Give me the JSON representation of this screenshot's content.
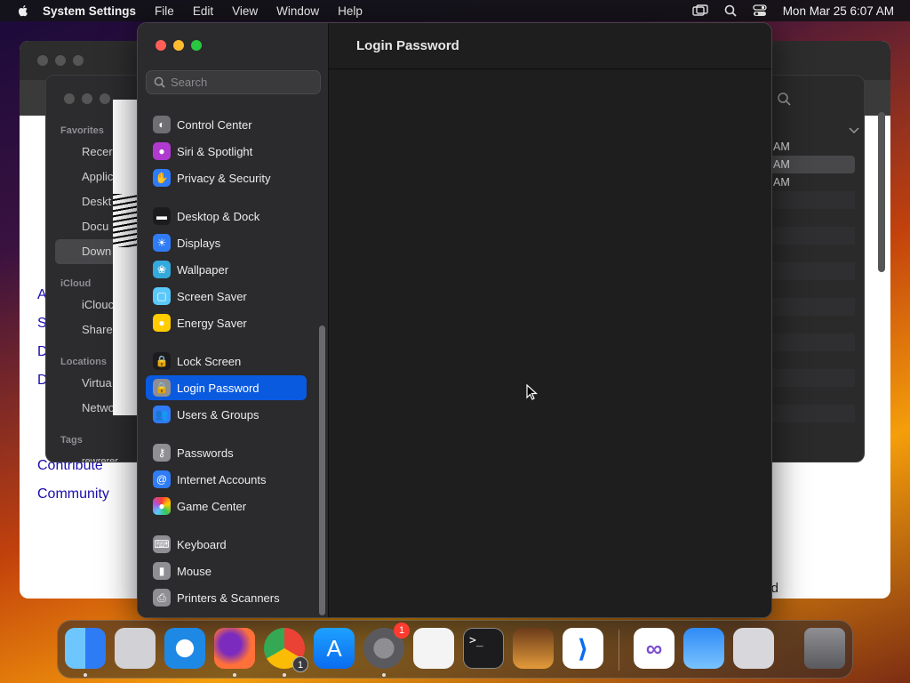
{
  "menubar": {
    "app_name": "System Settings",
    "menus": [
      "File",
      "Edit",
      "View",
      "Window",
      "Help"
    ],
    "clock": "Mon Mar 25  6:07 AM"
  },
  "background_browser": {
    "links": [
      "A",
      "S",
      "D",
      "D",
      "Contribute",
      "Community"
    ],
    "trailing_text": "d"
  },
  "background_finder": {
    "sections": {
      "favorites": "Favorites",
      "icloud": "iCloud",
      "locations": "Locations",
      "tags": "Tags"
    },
    "favorites": [
      "Recer",
      "Applic",
      "Deskt",
      "Docu",
      "Down"
    ],
    "icloud": [
      "iClouc",
      "Share"
    ],
    "locations": [
      "Virtua",
      "Netwo"
    ],
    "tag_partial": "rewrerer",
    "rows": [
      "AM",
      "AM",
      "AM"
    ]
  },
  "settings": {
    "search_placeholder": "Search",
    "content_title": "Login Password",
    "sidebar": [
      {
        "label": "Control Center",
        "icon": "control-center-icon",
        "color": "#6e6e73",
        "glyph": "◐"
      },
      {
        "label": "Siri & Spotlight",
        "icon": "siri-icon",
        "color": "#b03ad0",
        "glyph": "●"
      },
      {
        "label": "Privacy & Security",
        "icon": "hand-icon",
        "color": "#2f7cf6",
        "glyph": "✋"
      },
      {
        "label": "Desktop & Dock",
        "icon": "dock-icon",
        "color": "#1c1c1e",
        "glyph": "▬"
      },
      {
        "label": "Displays",
        "icon": "sun-icon",
        "color": "#2f7cf6",
        "glyph": "☀"
      },
      {
        "label": "Wallpaper",
        "icon": "flower-icon",
        "color": "#34aadc",
        "glyph": "❀"
      },
      {
        "label": "Screen Saver",
        "icon": "screensaver-icon",
        "color": "#5ac8fa",
        "glyph": "▢"
      },
      {
        "label": "Energy Saver",
        "icon": "bulb-icon",
        "color": "#ffcc00",
        "glyph": "●"
      },
      {
        "label": "Lock Screen",
        "icon": "lock-icon",
        "color": "#1c1c1e",
        "glyph": "🔒"
      },
      {
        "label": "Login Password",
        "icon": "lock-icon",
        "color": "#8e8e93",
        "glyph": "🔒"
      },
      {
        "label": "Users & Groups",
        "icon": "users-icon",
        "color": "#2f7cf6",
        "glyph": "👥"
      },
      {
        "label": "Passwords",
        "icon": "key-icon",
        "color": "#8e8e93",
        "glyph": "⚷"
      },
      {
        "label": "Internet Accounts",
        "icon": "at-icon",
        "color": "#2f7cf6",
        "glyph": "@"
      },
      {
        "label": "Game Center",
        "icon": "game-center-icon",
        "color": "#f2f2f7",
        "glyph": "●"
      },
      {
        "label": "Keyboard",
        "icon": "keyboard-icon",
        "color": "#8e8e93",
        "glyph": "⌨"
      },
      {
        "label": "Mouse",
        "icon": "mouse-icon",
        "color": "#8e8e93",
        "glyph": "▮"
      },
      {
        "label": "Printers & Scanners",
        "icon": "printer-icon",
        "color": "#8e8e93",
        "glyph": "⎙"
      }
    ],
    "selected_index": 9
  },
  "dock": {
    "apps": [
      {
        "name": "Finder",
        "icon": "finder-icon",
        "running": true
      },
      {
        "name": "Launchpad",
        "icon": "launchpad-icon",
        "running": false
      },
      {
        "name": "Safari",
        "icon": "safari-icon",
        "running": false
      },
      {
        "name": "Firefox",
        "icon": "firefox-icon",
        "running": true
      },
      {
        "name": "Chrome",
        "icon": "chrome-icon",
        "running": true,
        "badge": "1"
      },
      {
        "name": "App Store",
        "icon": "app-store-icon",
        "running": false
      },
      {
        "name": "System Settings",
        "icon": "system-settings-icon",
        "running": true,
        "badge": "1"
      },
      {
        "name": "TextEdit",
        "icon": "textedit-icon",
        "running": false
      },
      {
        "name": "Terminal",
        "icon": "terminal-icon",
        "running": false
      },
      {
        "name": "GarageBand",
        "icon": "garageband-icon",
        "running": false
      },
      {
        "name": "VS Code",
        "icon": "vscode-icon",
        "running": false
      },
      {
        "name": "Visual Studio",
        "icon": "visual-studio-icon",
        "running": false
      },
      {
        "name": "Weather",
        "icon": "weather-icon",
        "running": false
      },
      {
        "name": "Installer",
        "icon": "installer-icon",
        "running": false
      },
      {
        "name": "Trash",
        "icon": "trash-icon",
        "running": false
      }
    ]
  }
}
